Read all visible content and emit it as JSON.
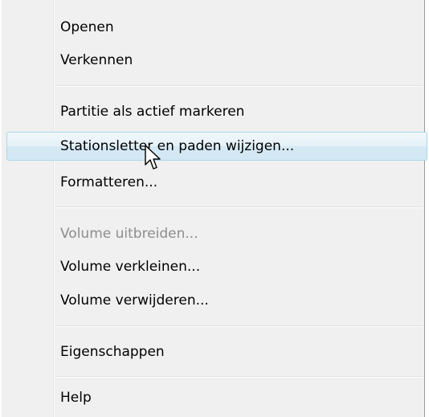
{
  "menu": {
    "items": [
      {
        "label": "Openen"
      },
      {
        "label": "Verkennen"
      },
      {
        "label": "Partitie als actief markeren"
      },
      {
        "label": "Stationsletter en paden wijzigen..."
      },
      {
        "label": "Formatteren..."
      },
      {
        "label": "Volume uitbreiden..."
      },
      {
        "label": "Volume verkleinen..."
      },
      {
        "label": "Volume verwijderen..."
      },
      {
        "label": "Eigenschappen"
      },
      {
        "label": "Help"
      }
    ]
  },
  "colors": {
    "menu_background": "#f0f0f0",
    "hover_border": "#a8d8eb",
    "disabled_text": "#8d8d8d"
  },
  "cursor": {
    "icon": "arrow-pointer-icon"
  }
}
